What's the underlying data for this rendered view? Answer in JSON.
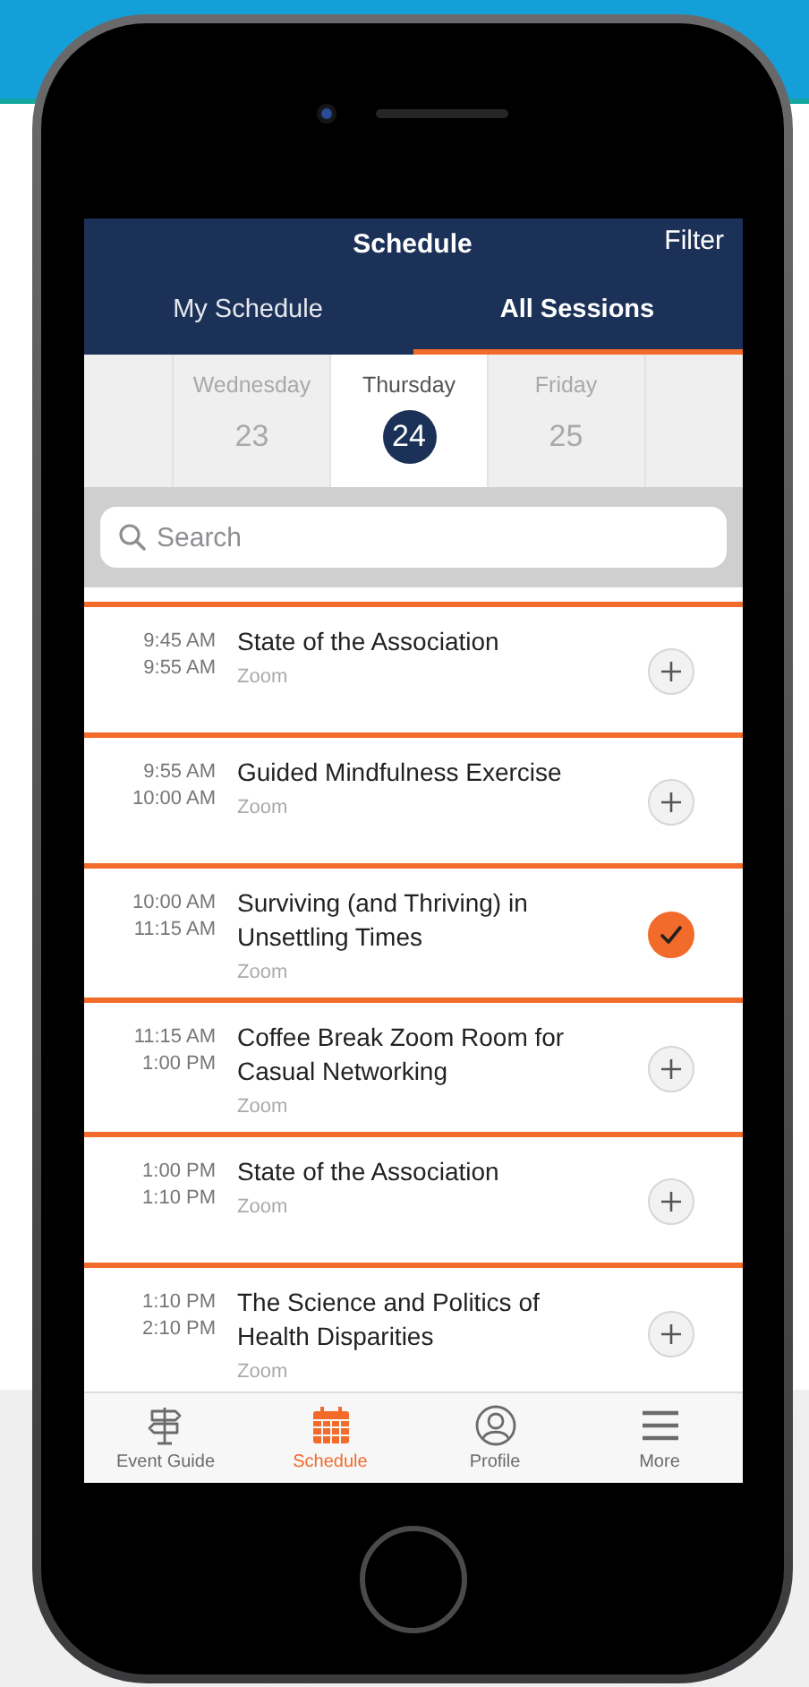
{
  "header": {
    "title": "Schedule",
    "filter": "Filter"
  },
  "tabs": [
    {
      "label": "My Schedule",
      "selected": false
    },
    {
      "label": "All Sessions",
      "selected": true
    }
  ],
  "days": [
    {
      "weekday": "Wednesday",
      "date": "23",
      "selected": false
    },
    {
      "weekday": "Thursday",
      "date": "24",
      "selected": true
    },
    {
      "weekday": "Friday",
      "date": "25",
      "selected": false
    }
  ],
  "search": {
    "placeholder": "Search"
  },
  "sessions": [
    {
      "start": "9:45 AM",
      "end": "9:55 AM",
      "title": "State of the Association",
      "location": "Zoom",
      "added": false
    },
    {
      "start": "9:55 AM",
      "end": "10:00 AM",
      "title": "Guided Mindfulness Exercise",
      "location": "Zoom",
      "added": false
    },
    {
      "start": "10:00 AM",
      "end": "11:15 AM",
      "title": "Surviving (and Thriving) in Unsettling Times",
      "location": "Zoom",
      "added": true
    },
    {
      "start": "11:15 AM",
      "end": "1:00 PM",
      "title": "Coffee Break Zoom Room for Casual Networking",
      "location": "Zoom",
      "added": false
    },
    {
      "start": "1:00 PM",
      "end": "1:10 PM",
      "title": "State of the Association",
      "location": "Zoom",
      "added": false
    },
    {
      "start": "1:10 PM",
      "end": "2:10 PM",
      "title": "The Science and Politics of Health Disparities",
      "location": "Zoom",
      "added": false
    }
  ],
  "tab_bar": [
    {
      "label": "Event Guide",
      "kind": "signpost",
      "selected": false
    },
    {
      "label": "Schedule",
      "kind": "calendar",
      "selected": true
    },
    {
      "label": "Profile",
      "kind": "person",
      "selected": false
    },
    {
      "label": "More",
      "kind": "menu",
      "selected": false
    }
  ]
}
